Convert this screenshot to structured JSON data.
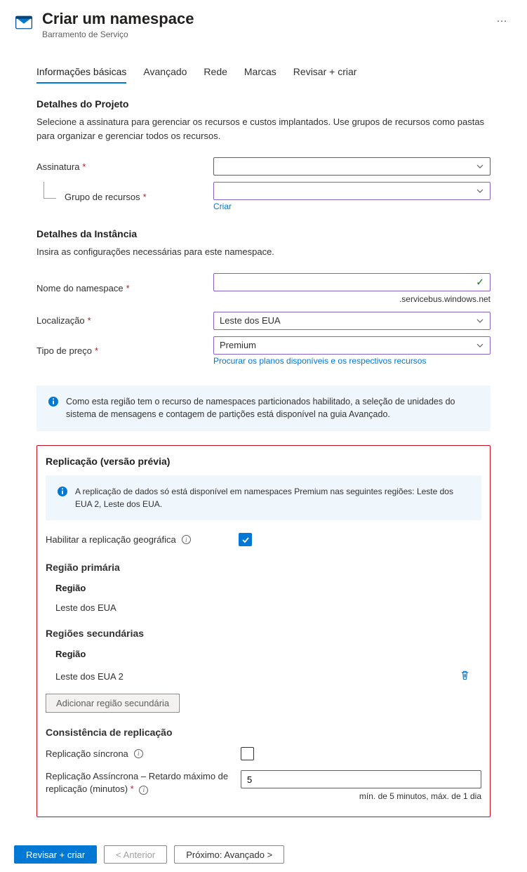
{
  "header": {
    "title": "Criar um namespace",
    "subtitle": "Barramento de Serviço",
    "more": "…"
  },
  "tabs": {
    "basics": "Informações básicas",
    "advanced": "Avançado",
    "network": "Rede",
    "tags": "Marcas",
    "review": "Revisar + criar"
  },
  "project": {
    "heading": "Detalhes do Projeto",
    "desc": "Selecione a assinatura para gerenciar os recursos e custos implantados. Use grupos de recursos como pastas para organizar e gerenciar todos os recursos.",
    "sub_label": "Assinatura",
    "sub_value": "",
    "rg_label": "Grupo de recursos",
    "rg_value": "",
    "rg_create": "Criar"
  },
  "instance": {
    "heading": "Detalhes da Instância",
    "desc": "Insira as configurações necessárias para este namespace.",
    "name_label": "Nome do namespace",
    "name_value": "",
    "name_suffix": ".servicebus.windows.net",
    "loc_label": "Localização",
    "loc_value": "Leste dos EUA",
    "price_label": "Tipo de preço",
    "price_value": "Premium",
    "price_link": "Procurar os planos disponíveis e os respectivos recursos"
  },
  "info1": "Como esta região tem o recurso de namespaces particionados habilitado, a seleção de unidades do sistema de mensagens e contagem de partições está disponível na guia Avançado.",
  "replication": {
    "heading": "Replicação (versão prévia)",
    "info": "A replicação de dados só está disponível em namespaces Premium nas seguintes regiões: Leste dos EUA 2, Leste dos EUA.",
    "enable_label": "Habilitar a replicação geográfica",
    "primary_heading": "Região primária",
    "region_col": "Região",
    "primary_region": "Leste dos EUA",
    "secondary_heading": "Regiões secundárias",
    "secondary_region": "Leste dos EUA 2",
    "add_secondary": "Adicionar região secundária",
    "consistency_heading": "Consistência de replicação",
    "sync_label": "Replicação síncrona",
    "async_label": "Replicação Assíncrona – Retardo máximo de replicação (minutos)",
    "async_value": "5",
    "async_help": "mín. de 5 minutos, máx. de 1 dia"
  },
  "footer": {
    "review": "Revisar + criar",
    "prev": "< Anterior",
    "next": "Próximo: Avançado >"
  }
}
